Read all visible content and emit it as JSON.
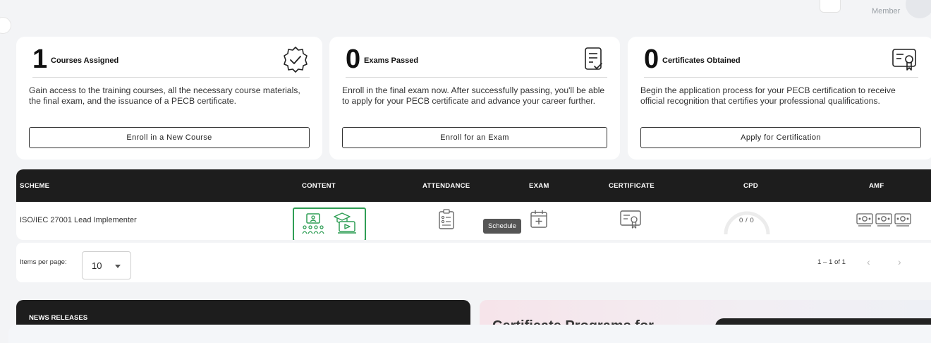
{
  "header": {
    "role": "Member"
  },
  "cards": [
    {
      "count": "1",
      "title": "Courses Assigned",
      "desc": "Gain access to the training courses, all the necessary course materials, the final exam, and the issuance of a PECB certificate.",
      "button": "Enroll in a New Course",
      "icon": "check-badge-icon"
    },
    {
      "count": "0",
      "title": "Exams Passed",
      "desc": "Enroll in the final exam now. After successfully passing, you'll be able to apply for your PECB certificate and advance your career further.",
      "button": "Enroll for an Exam",
      "icon": "exam-document-icon"
    },
    {
      "count": "0",
      "title": "Certificates Obtained",
      "desc": "Begin the application process for your PECB certification to receive official recognition that certifies your professional qualifications.",
      "button": "Apply for Certification",
      "icon": "certificate-icon"
    }
  ],
  "table": {
    "columns": [
      "SCHEME",
      "CONTENT",
      "ATTENDANCE",
      "EXAM",
      "CERTIFICATE",
      "CPD",
      "AMF"
    ],
    "rows": [
      {
        "scheme": "ISO/IEC 27001 Lead Implementer",
        "cpd": "0 / 0",
        "tooltip": "Schedule"
      }
    ],
    "colors": {
      "accent_green": "#2f9e55",
      "header_bg": "#1d1d1d"
    }
  },
  "pagination": {
    "items_per_page_label": "Items per page:",
    "items_per_page_value": "10",
    "range": "1 – 1 of 1",
    "prev": "‹",
    "next": "›"
  },
  "news": {
    "title": "NEWS RELEASES"
  },
  "promo": {
    "title": "Certificate Programs for"
  }
}
